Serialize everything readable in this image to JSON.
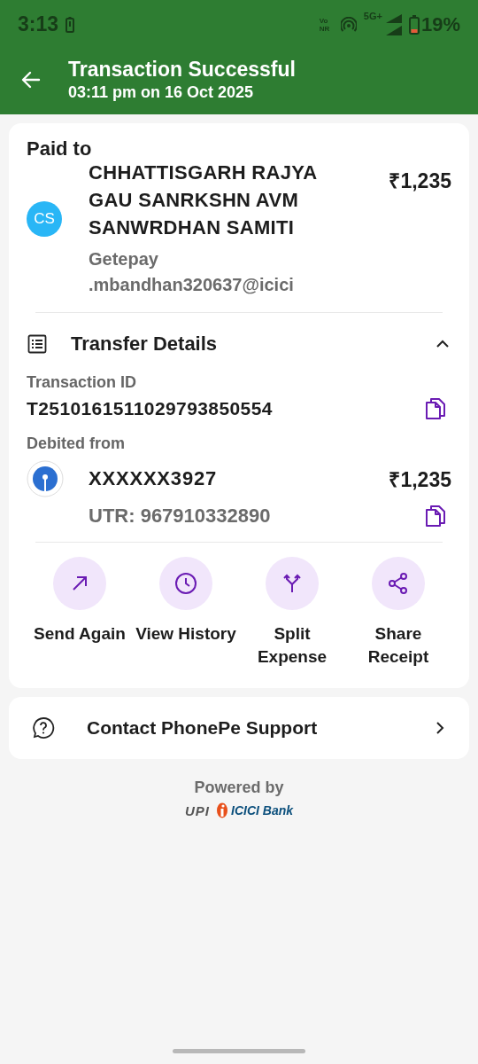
{
  "status_bar": {
    "time": "3:13",
    "volte": "Vo NR",
    "network": "5G+",
    "battery": "19%"
  },
  "header": {
    "title": "Transaction Successful",
    "subtitle": "03:11 pm on 16 Oct 2025"
  },
  "paid_to": {
    "label": "Paid to",
    "initials": "CS",
    "name": "CHHATTISGARH RAJYA GAU SANRKSHN AVM SANWRDHAN SAMITI",
    "amount": "₹1,235",
    "upi_id": "Getepay .mbandhan320637@icici"
  },
  "transfer_details": {
    "title": "Transfer Details",
    "expanded": true,
    "transaction_id_label": "Transaction ID",
    "transaction_id": "T2510161511029793850554",
    "debited_label": "Debited from",
    "account": "XXXXXX3927",
    "amount": "₹1,235",
    "utr": "UTR: 967910332890"
  },
  "actions": [
    {
      "kind": "send",
      "label": "Send Again"
    },
    {
      "kind": "history",
      "label": "View History"
    },
    {
      "kind": "split",
      "label": "Split Expense"
    },
    {
      "kind": "share",
      "label": "Share Receipt"
    }
  ],
  "support": {
    "label": "Contact PhonePe Support"
  },
  "footer": {
    "powered_by": "Powered by",
    "upi": "UPI",
    "bank": "ICICI Bank"
  }
}
